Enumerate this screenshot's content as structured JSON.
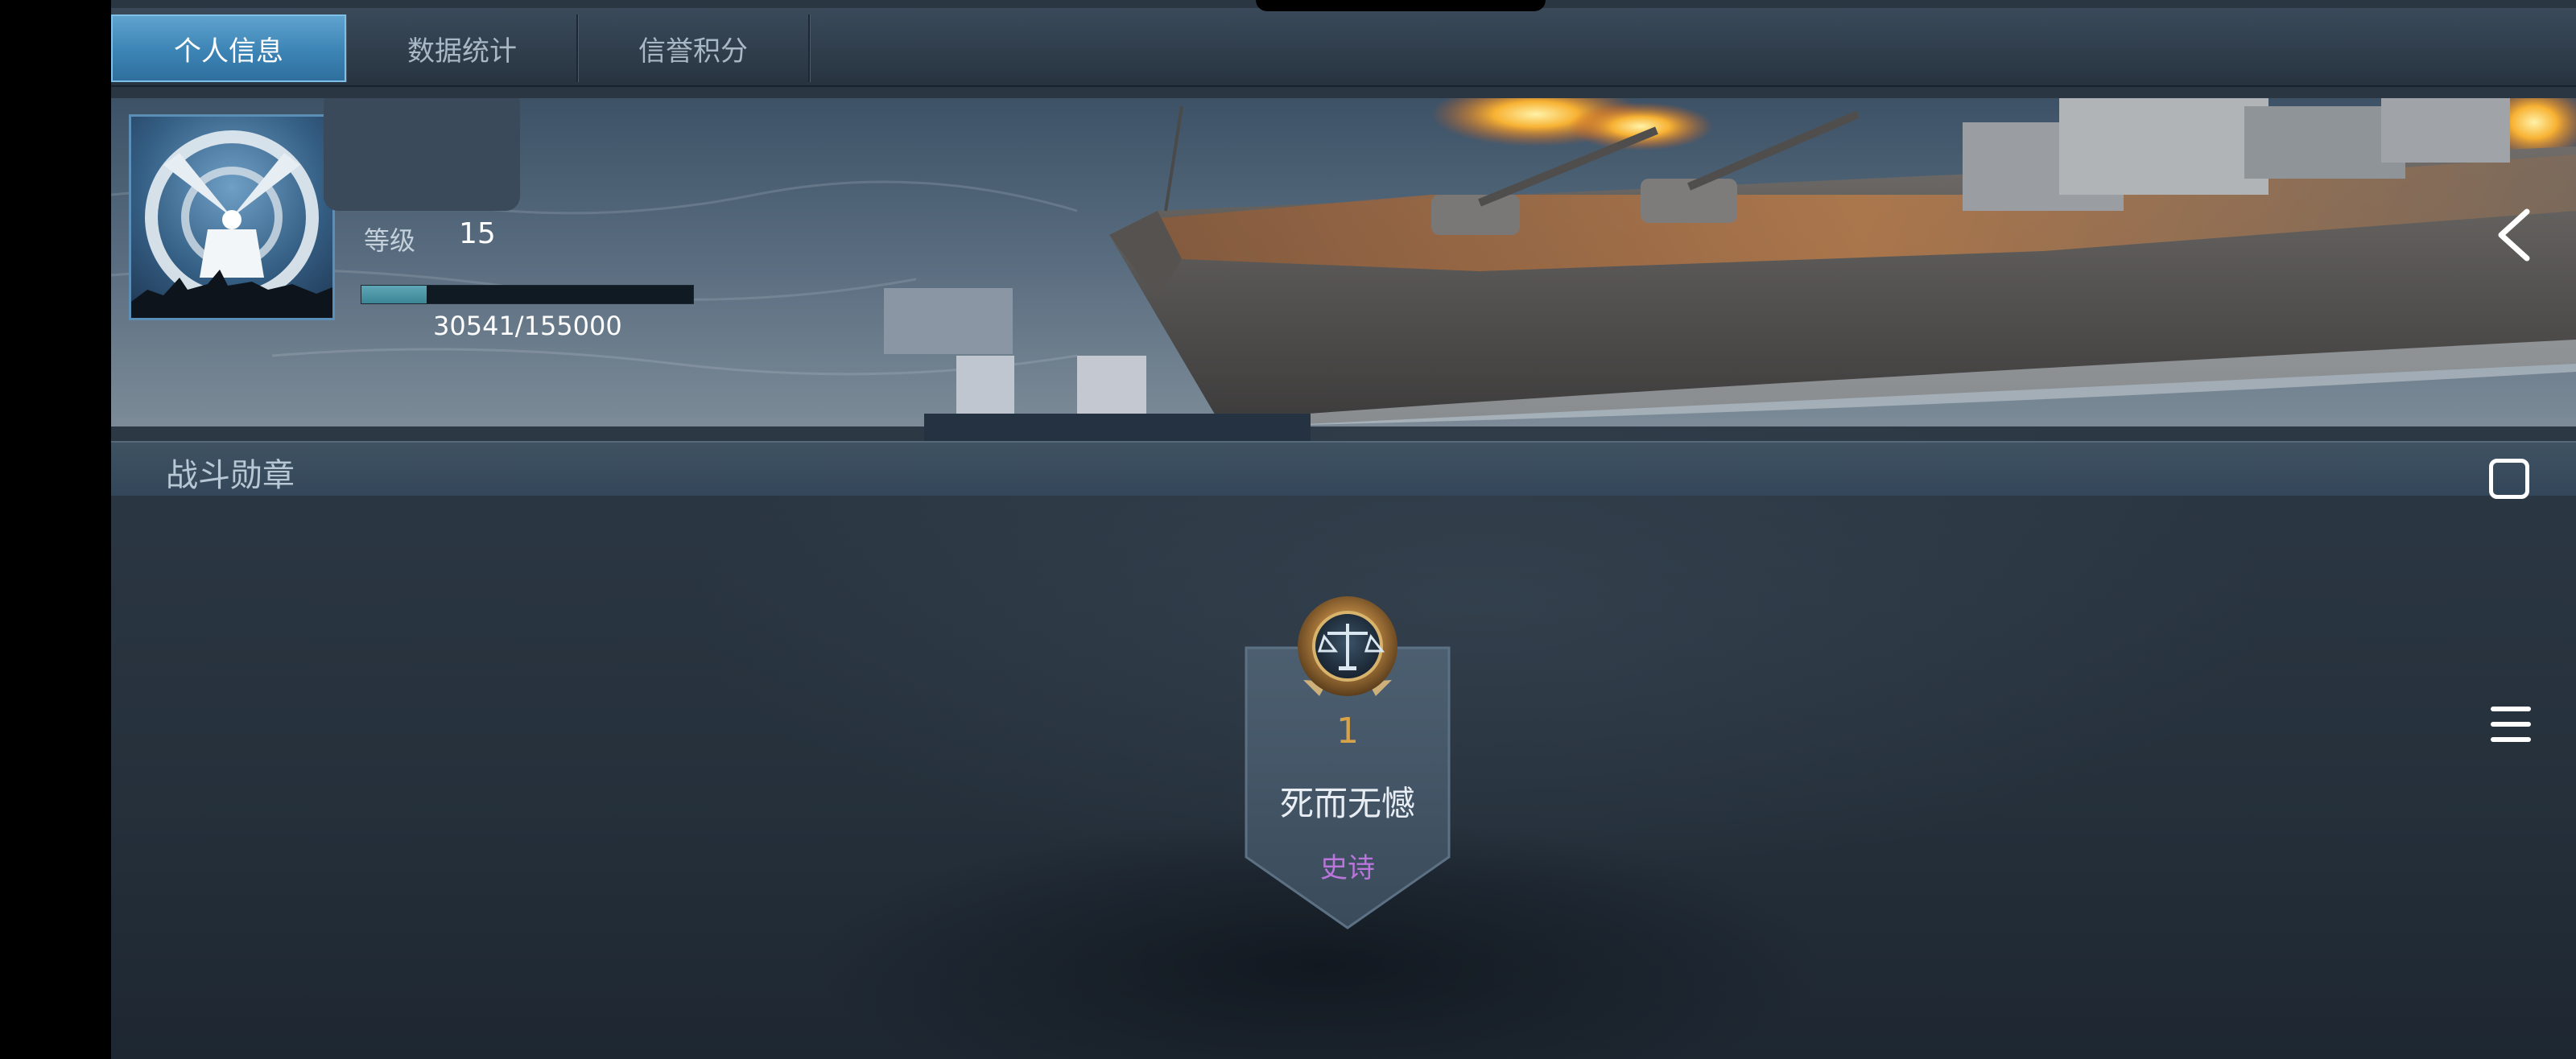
{
  "tabs": [
    {
      "label": "个人信息",
      "active": true
    },
    {
      "label": "数据统计",
      "active": false
    },
    {
      "label": "信誉积分",
      "active": false
    }
  ],
  "profile": {
    "level_label": "等级",
    "level_value": "15",
    "exp_current": 30541,
    "exp_max": 155000,
    "exp_text": "30541/155000",
    "exp_progress": 0.197
  },
  "medals_section": {
    "title": "战斗勋章",
    "medals": [
      {
        "count": "1",
        "name": "死而无憾",
        "rarity": "史诗",
        "icon": "scales-medal-icon"
      }
    ]
  },
  "icons": {
    "back": "chevron-left-icon",
    "window": "square-outline-icon",
    "menu": "hamburger-menu-icon"
  },
  "colors": {
    "active_tab": "#3c84b5",
    "medal_count": "#d8a24a",
    "rarity_epic": "#b975d9",
    "exp_fill": "#4b95a6"
  }
}
